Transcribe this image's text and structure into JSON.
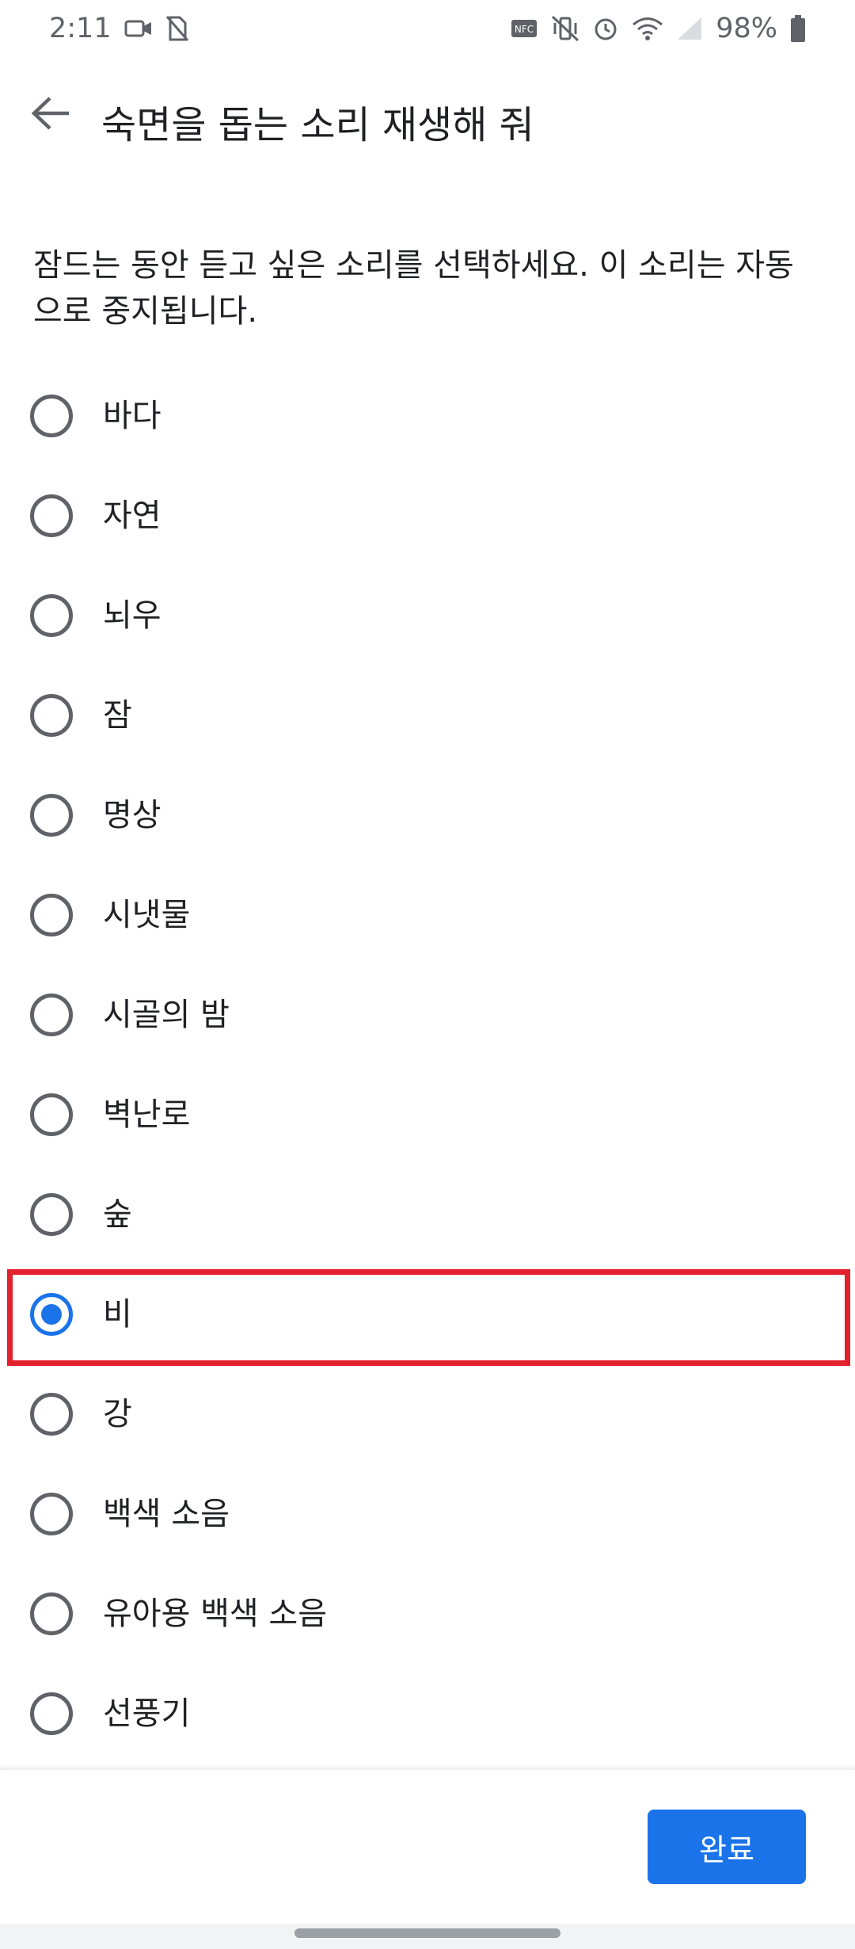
{
  "status_bar": {
    "time": "2:11",
    "battery": "98%"
  },
  "app_bar": {
    "title": "숙면을 돕는 소리 재생해 줘"
  },
  "description": "잠드는 동안 듣고 싶은 소리를 선택하세요. 이 소리는 자동으로 중지됩니다.",
  "options": [
    {
      "label": "바다",
      "selected": false
    },
    {
      "label": "자연",
      "selected": false
    },
    {
      "label": "뇌우",
      "selected": false
    },
    {
      "label": "잠",
      "selected": false
    },
    {
      "label": "명상",
      "selected": false
    },
    {
      "label": "시냇물",
      "selected": false
    },
    {
      "label": "시골의 밤",
      "selected": false
    },
    {
      "label": "벽난로",
      "selected": false
    },
    {
      "label": "숲",
      "selected": false
    },
    {
      "label": "비",
      "selected": true
    },
    {
      "label": "강",
      "selected": false
    },
    {
      "label": "백색 소음",
      "selected": false
    },
    {
      "label": "유아용 백색 소음",
      "selected": false
    },
    {
      "label": "선풍기",
      "selected": false
    }
  ],
  "footer": {
    "done_label": "완료"
  },
  "colors": {
    "accent": "#1a73e8",
    "highlight": "#e3202d",
    "text": "#202124",
    "secondary": "#5f6368"
  }
}
